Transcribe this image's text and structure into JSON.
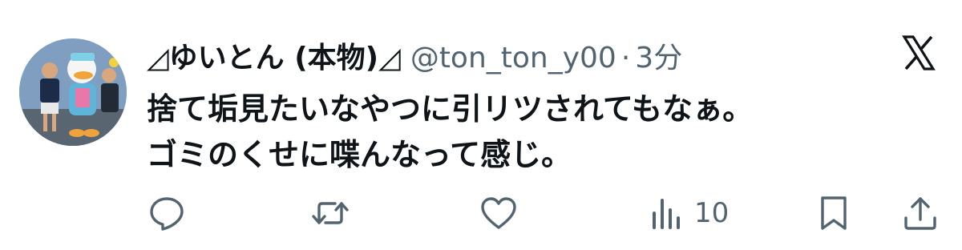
{
  "tweet": {
    "author": {
      "display_name": "◿ゆいとん (本物)◿",
      "handle": "@ton_ton_y00",
      "avatar": "avatar-photo"
    },
    "separator": "·",
    "time": "3分",
    "brand_icon": "x-logo-icon",
    "text_lines": [
      "捨て垢見たいなやつに引リツされてもなぁ。",
      "ゴミのくせに喋んなって感じ。"
    ],
    "actions": {
      "reply": {
        "icon": "reply-icon"
      },
      "retweet": {
        "icon": "retweet-icon"
      },
      "like": {
        "icon": "heart-icon"
      },
      "views": {
        "icon": "views-chart-icon",
        "count": "10"
      },
      "bookmark": {
        "icon": "bookmark-icon"
      },
      "share": {
        "icon": "share-icon"
      }
    }
  },
  "colors": {
    "text_primary": "#0f1419",
    "text_secondary": "#536471",
    "icon": "#536471",
    "background": "#ffffff"
  }
}
